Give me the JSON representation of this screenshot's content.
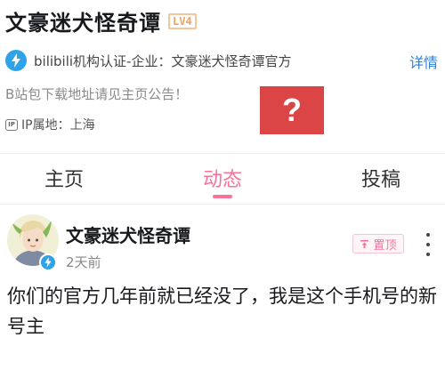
{
  "profile": {
    "name": "文豪迷犬怪奇谭",
    "level": "LV4",
    "verification": "bilibili机构认证-企业：文豪迷犬怪奇谭官方",
    "detail_link": "详情",
    "bio": "B站包下载地址请见主页公告！",
    "ip_label": "IP属地：上海",
    "ip_icon_text": "IP"
  },
  "overlay": {
    "symbol": "?"
  },
  "tabs": [
    {
      "label": "主页",
      "active": false
    },
    {
      "label": "动态",
      "active": true
    },
    {
      "label": "投稿",
      "active": false
    }
  ],
  "post": {
    "author": "文豪迷犬怪奇谭",
    "time": "2天前",
    "pin_label": "置顶",
    "content": "你们的官方几年前就已经没了，我是这个手机号的新号主"
  },
  "colors": {
    "accent_pink": "#fb7299",
    "link_blue": "#2a82d6",
    "verify_blue": "#2ea3e7",
    "overlay_red": "#dc4545"
  }
}
